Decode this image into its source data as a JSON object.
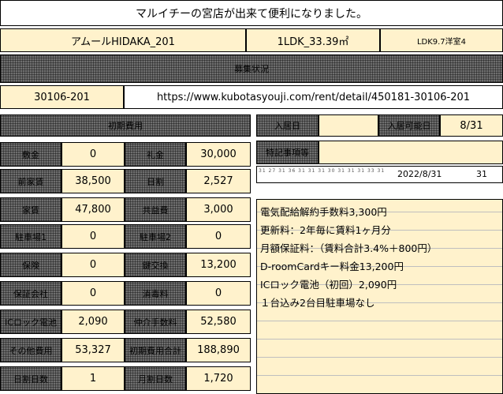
{
  "header": {
    "title": "マルイチーの宮店が出来て便利になりました。"
  },
  "property": {
    "name": "アムールHIDAKA_201",
    "layout": "1LDK_33.39㎡",
    "rooms": "LDK9.7洋室4"
  },
  "section_bar": {
    "label": "募集状況"
  },
  "listing": {
    "id": "30106-201",
    "url": "https://www.kubotasyouji.com/rent/detail/450181-30106-201"
  },
  "fees": {
    "header": "初期費用",
    "rows": [
      {
        "l_label": "敷金",
        "l_value": "0",
        "r_label": "礼金",
        "r_value": "30,000"
      },
      {
        "l_label": "前家賃",
        "l_value": "38,500",
        "r_label": "日割",
        "r_value": "2,527"
      },
      {
        "l_label": "家賃",
        "l_value": "47,800",
        "r_label": "共益費",
        "r_value": "3,000"
      },
      {
        "l_label": "駐車場1",
        "l_value": "0",
        "r_label": "駐車場2",
        "r_value": "0"
      },
      {
        "l_label": "保険",
        "l_value": "0",
        "r_label": "鍵交換",
        "r_value": "13,200"
      },
      {
        "l_label": "保証会社",
        "l_value": "0",
        "r_label": "消毒料",
        "r_value": "0"
      },
      {
        "l_label": "ICロック電池",
        "l_value": "2,090",
        "r_label": "仲介手数料",
        "r_value": "52,580"
      },
      {
        "l_label": "その他費用",
        "l_value": "53,327",
        "r_label": "初期費用合計",
        "r_value": "188,890"
      },
      {
        "l_label": "日割日数",
        "l_value": "1",
        "r_label": "月割日数",
        "r_value": "1,720"
      }
    ]
  },
  "info": {
    "move_in_label": "入居日",
    "move_in_value": "",
    "contract_label": "入居可能日",
    "contract_value": "8/31",
    "memo_label": "特記事項等",
    "memo_value": "",
    "calendar_date": "2022/8/31",
    "calendar_days": "31",
    "calendar_tiny": "31 27 31 36 31 31 31 30 31 31 31 33 31"
  },
  "notes": [
    "電気配給解約手数料3,300円",
    "更新料：2年毎に賃料1ヶ月分",
    "月額保証料：（賃料合計3.4%＋800円）",
    "D-roomCardキー料金13,200円",
    "ICロック電池（初回）2,090円",
    "１台込み2台目駐車場なし"
  ]
}
